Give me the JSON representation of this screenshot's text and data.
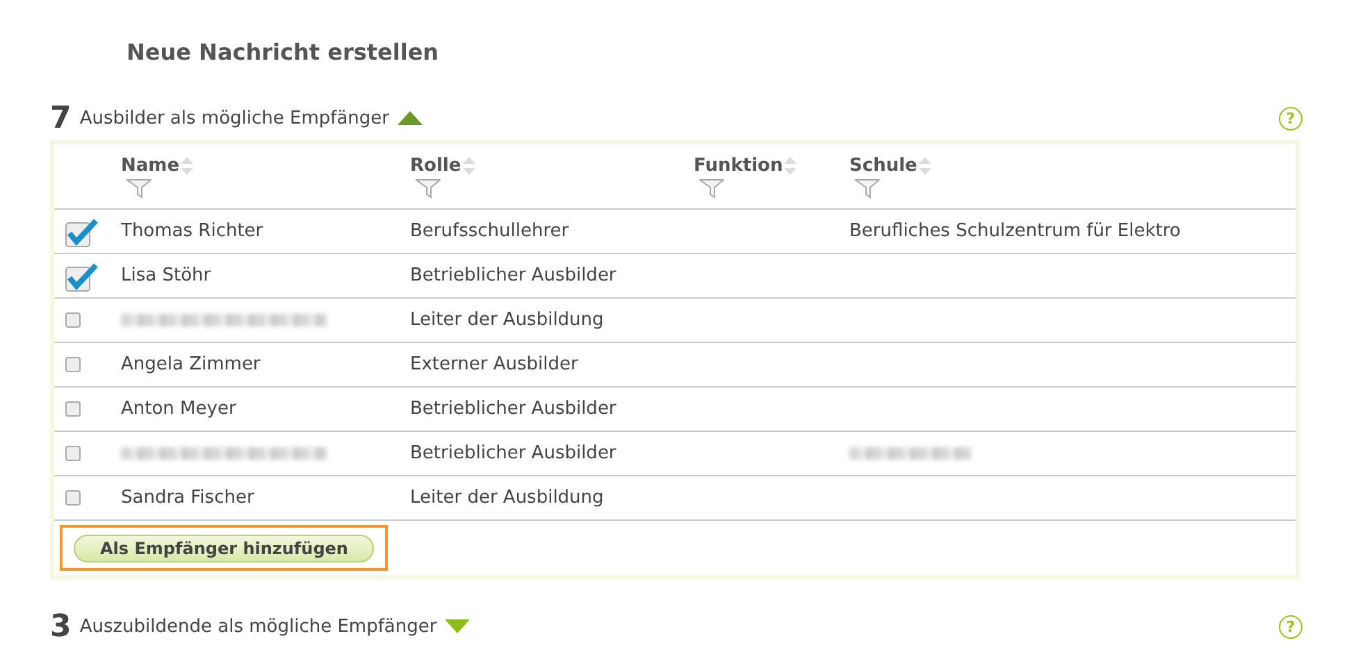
{
  "title": "Neue Nachricht erstellen",
  "sections": [
    {
      "count": "7",
      "label": "Ausbilder als mögliche Empfänger",
      "expanded": true,
      "help": "?",
      "table": {
        "columns": [
          "Name",
          "Rolle",
          "Funktion",
          "Schule"
        ],
        "rows": [
          {
            "checked": true,
            "name": "Thomas Richter",
            "role": "Berufsschullehrer",
            "school": "Berufliches Schulzentrum für Elektro"
          },
          {
            "checked": true,
            "name": "Lisa Stöhr",
            "role": "Betrieblicher Ausbilder"
          },
          {
            "checked": false,
            "name_blurred": true,
            "role": "Leiter der Ausbildung"
          },
          {
            "checked": false,
            "name": "Angela Zimmer",
            "role": "Externer Ausbilder"
          },
          {
            "checked": false,
            "name": "Anton Meyer",
            "role": "Betrieblicher Ausbilder"
          },
          {
            "checked": false,
            "name_blurred": true,
            "role": "Betrieblicher Ausbilder",
            "school_blurred": true
          },
          {
            "checked": false,
            "name": "Sandra Fischer",
            "role": "Leiter der Ausbildung"
          }
        ],
        "button": {
          "label": "Als Empfänger hinzufügen",
          "focused": true
        }
      }
    },
    {
      "count": "3",
      "label": "Auszubildende als mögliche Empfänger",
      "expanded": false,
      "help": "?"
    }
  ]
}
